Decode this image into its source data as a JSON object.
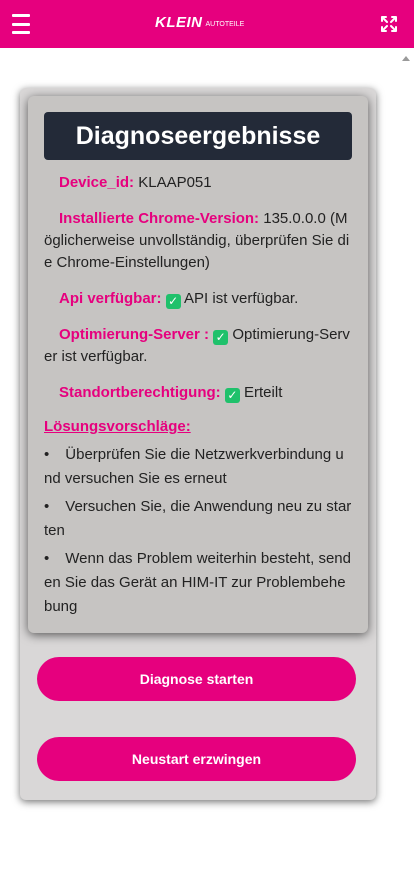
{
  "header": {
    "brand": "KLEIN",
    "brand_sub": "AUTOTEILE",
    "menu_icon": "hamburger-icon",
    "expand_icon": "fullscreen-icon"
  },
  "colors": {
    "accent": "#e6007e",
    "title_bg": "#232a38",
    "success": "#1fc16b"
  },
  "diagnosis": {
    "title": "Diagnoseergebnisse",
    "rows": [
      {
        "label": "Device_id:",
        "value": "KLAAP051",
        "check": false
      },
      {
        "label": "Installierte Chrome-Version:",
        "value": "135.0.0.0 (Möglicherweise unvollständig, überprüfen Sie die Chrome-Einstellungen)",
        "check": false
      },
      {
        "label": "Api verfügbar:",
        "value": "API ist verfügbar.",
        "check": true
      },
      {
        "label": "Optimierung-Server :",
        "value": "Optimierung-Server ist verfügbar.",
        "check": true
      },
      {
        "label": "Standortberechtigung:",
        "value": "Erteilt",
        "check": true
      }
    ],
    "solutions_heading": "Lösungsvorschläge:",
    "solutions": [
      "Überprüfen Sie die Netzwerkverbindung und versuchen Sie es erneut",
      "Versuchen Sie, die Anwendung neu zu starten",
      "Wenn das Problem weiterhin besteht, senden Sie das Gerät an HIM-IT zur Problembehebung"
    ]
  },
  "actions": {
    "start_label": "Diagnose starten",
    "restart_label": "Neustart erzwingen"
  }
}
